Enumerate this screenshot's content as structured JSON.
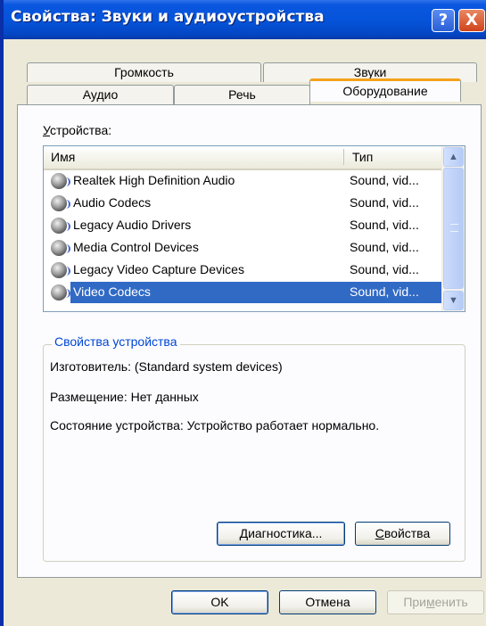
{
  "window": {
    "title": "Свойства: Звуки и аудиоустройства"
  },
  "titlebar_buttons": {
    "help": "?",
    "close": "X"
  },
  "tabs": {
    "row_back": [
      {
        "label": "Громкость"
      },
      {
        "label": "Звуки"
      }
    ],
    "row_front": [
      {
        "label": "Аудио"
      },
      {
        "label": "Речь"
      },
      {
        "label": "Оборудование",
        "active": true
      }
    ]
  },
  "devices": {
    "label_prefix": "У",
    "label_rest": "стройства:",
    "columns": {
      "name": "Имя",
      "type": "Тип"
    },
    "rows": [
      {
        "name": "Realtek High Definition Audio",
        "type": "Sound, vid..."
      },
      {
        "name": "Audio Codecs",
        "type": "Sound, vid..."
      },
      {
        "name": "Legacy Audio Drivers",
        "type": "Sound, vid..."
      },
      {
        "name": "Media Control Devices",
        "type": "Sound, vid..."
      },
      {
        "name": "Legacy Video Capture Devices",
        "type": "Sound, vid..."
      },
      {
        "name": "Video Codecs",
        "type": "Sound, vid...",
        "selected": true
      }
    ],
    "scroll": {
      "up": "▲",
      "down": "▼"
    }
  },
  "device_properties": {
    "title": "Свойства устройства",
    "manufacturer": "Изготовитель: (Standard system devices)",
    "location": "Размещение: Нет данных",
    "status": "Состояние устройства: Устройство работает нормально.",
    "troubleshoot_prefix": "Д",
    "troubleshoot_rest": "иагностика...",
    "properties_prefix": "С",
    "properties_rest": "войства"
  },
  "dialog_buttons": {
    "ok": "OK",
    "cancel": "Отмена",
    "apply_a": "При",
    "apply_u": "м",
    "apply_b": "енить"
  },
  "colors": {
    "title_bar": "#0553D8",
    "selection": "#316AC5",
    "group_title": "#0046D5",
    "active_tab_accent": "#F4A21C"
  }
}
